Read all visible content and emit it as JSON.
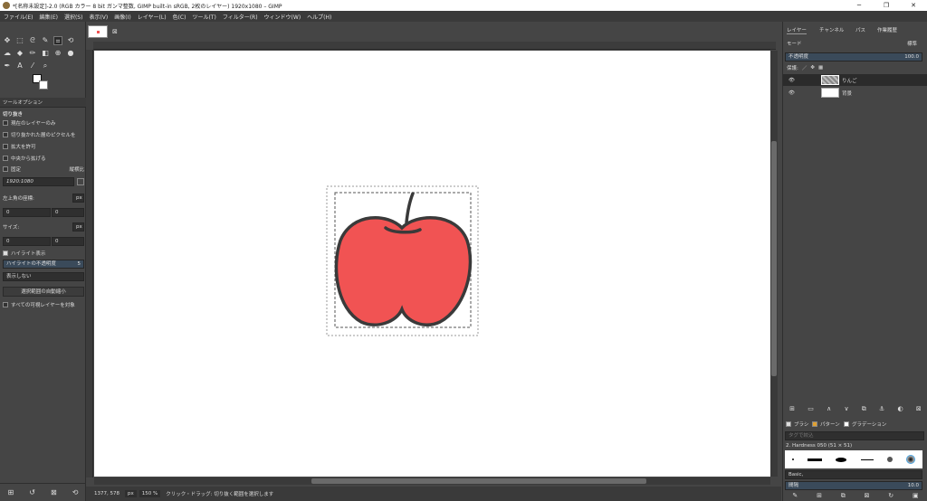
{
  "titlebar": {
    "title": "*[名称未設定]-2.0 (RGB カラー 8 bit ガンマ整数, GIMP built-in sRGB, 2枚のレイヤー) 1920x1080 – GIMP"
  },
  "menu": [
    "ファイル(E)",
    "編集(E)",
    "選択(S)",
    "表示(V)",
    "画像(I)",
    "レイヤー(L)",
    "色(C)",
    "ツール(T)",
    "フィルター(R)",
    "ウィンドウ(W)",
    "ヘルプ(H)"
  ],
  "tool_options": {
    "tab": "ツールオプション",
    "title": "切り抜き",
    "checks": [
      "現在のレイヤーのみ",
      "切り抜かれた層のピクセルを",
      "拡大を許可",
      "中央から拡げる"
    ],
    "fixed_label": "固定",
    "fixed_mode": "縦横比",
    "ratio_value": "1920:1080",
    "pos_label": "左上角の座標:",
    "pos_unit": "px",
    "pos_x": "0",
    "pos_y": "0",
    "size_label": "サイズ:",
    "size_unit": "px",
    "size_w": "0",
    "size_h": "0",
    "highlight_label": "ハイライト表示",
    "highlight_opacity_label": "ハイライトの不透明度",
    "highlight_opacity_value": "5",
    "guides_value": "表示しない",
    "autoshrink_label": "選択範囲の自動縮小",
    "merged_label": "すべての可視レイヤーを対象"
  },
  "image_tab": {
    "close": "⊠"
  },
  "status": {
    "coords": "1377, 578",
    "unit": "px",
    "zoom": "150 %",
    "message": "クリック・ドラッグ: 切り抜く範囲を選択します"
  },
  "layers_panel": {
    "tabs": [
      "レイヤー",
      "チャンネル",
      "パス",
      "作業履歴"
    ],
    "mode_label": "モード",
    "mode_value": "標準",
    "opacity_label": "不透明度",
    "opacity_value": "100.0",
    "lock_label": "保護:",
    "layers": [
      {
        "name": "りんご",
        "selected": true
      },
      {
        "name": "背景",
        "selected": false
      }
    ]
  },
  "brushes_panel": {
    "tabs": [
      "ブラシ",
      "パターン",
      "グラデーション"
    ],
    "filter_placeholder": "タグで絞込",
    "brush_name": "2. Hardness 050 (51 × 51)",
    "preset": "Basic,",
    "spacing_label": "間隔",
    "spacing_value": "10.0"
  },
  "colors": {
    "accent": "#f15353",
    "outline": "#3a3a3a",
    "ui_bg": "#454545"
  }
}
